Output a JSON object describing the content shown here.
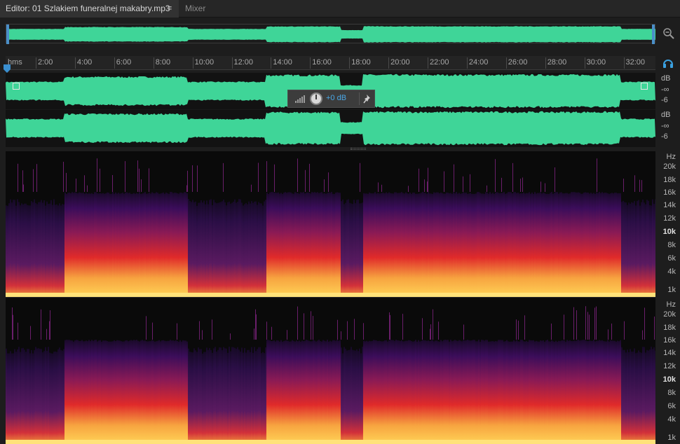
{
  "tabs": [
    {
      "label": "Editor: 01 Szlakiem funeralnej makabry.mp3",
      "active": true
    },
    {
      "label": "Mixer",
      "active": false
    }
  ],
  "tab_menu_glyph": "≡",
  "ruler": {
    "unit": "hms",
    "ticks": [
      "2:00",
      "4:00",
      "6:00",
      "8:00",
      "10:00",
      "12:00",
      "14:00",
      "16:00",
      "18:00",
      "20:00",
      "22:00",
      "24:00",
      "26:00",
      "28:00",
      "30:00",
      "32:00"
    ]
  },
  "hud": {
    "gain": "+0 dB"
  },
  "db_scale": {
    "channel_1": [
      "dB",
      "-∞",
      "-6"
    ],
    "channel_2": [
      "dB",
      "-∞",
      "-6"
    ]
  },
  "hz_scale": {
    "channel_1": [
      "Hz",
      "20k",
      "18k",
      "16k",
      "14k",
      "12k",
      "10k",
      "8k",
      "6k",
      "4k",
      "1k"
    ],
    "channel_2": [
      "Hz",
      "20k",
      "18k",
      "16k",
      "14k",
      "12k",
      "10k",
      "8k",
      "6k",
      "4k",
      "1k"
    ]
  },
  "colors": {
    "waveform": "#3fd598",
    "spectrum_low": "#ffd457",
    "spectrum_mid": "#e02a2a",
    "spectrum_high": "#3b0d5a",
    "accent": "#4aa7e6"
  },
  "icons": {
    "zoom": "zoom-out-icon",
    "headphone": "headphone-icon",
    "volume": "volume-icon",
    "pin": "pin-icon",
    "playhead": "playhead-icon"
  }
}
